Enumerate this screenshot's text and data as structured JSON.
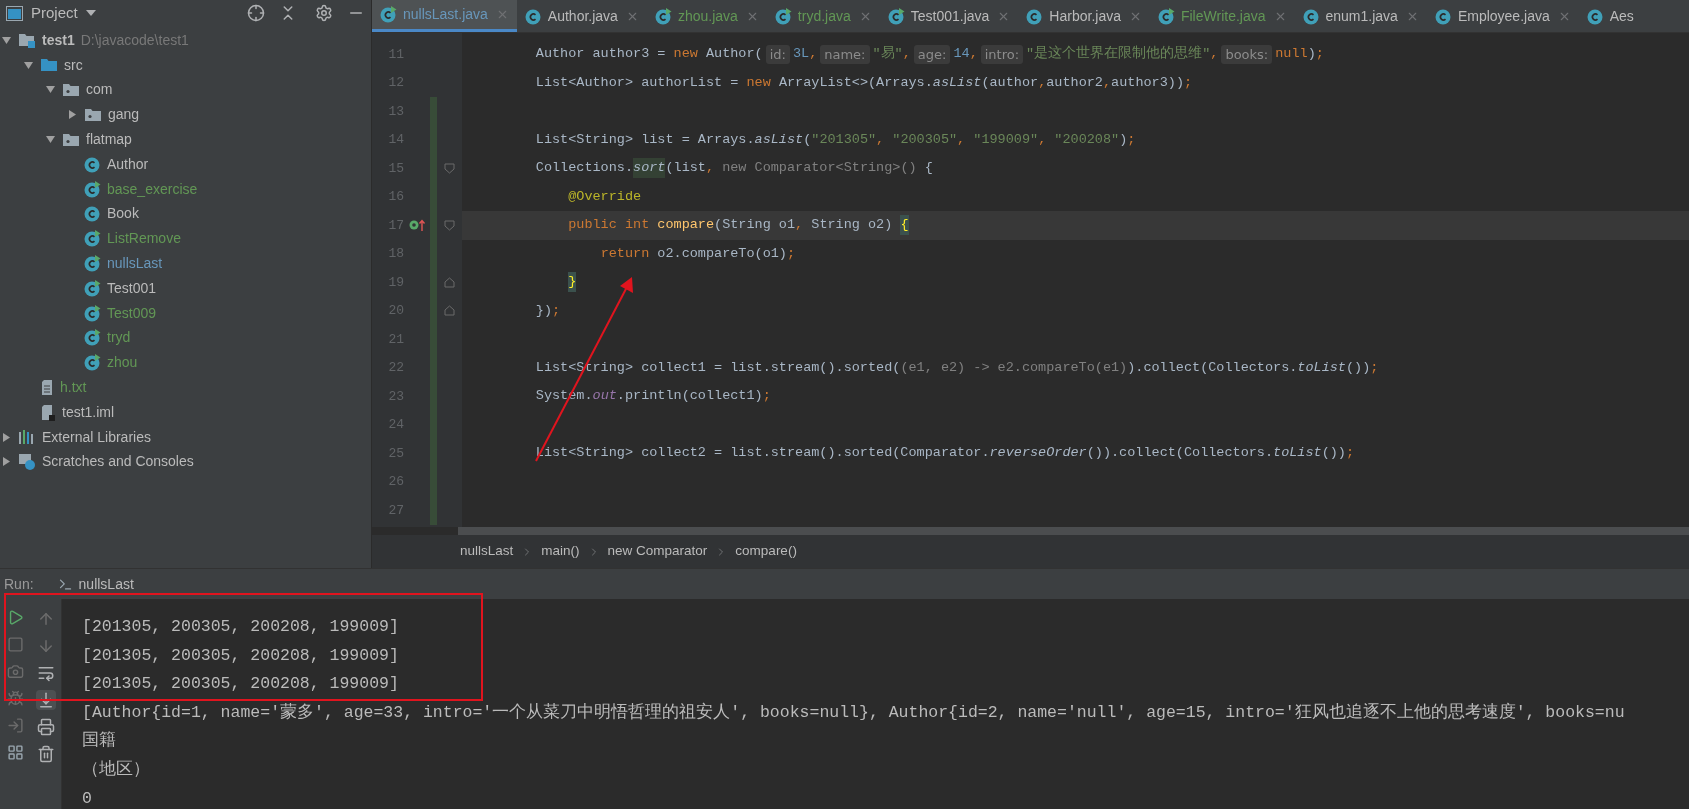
{
  "sidebar": {
    "title": "Project",
    "tree": [
      {
        "label": "test1",
        "kind": "project",
        "hint": "D:\\javacode\\test1",
        "expanded": true,
        "color": "#bbbbbb",
        "children": [
          {
            "label": "src",
            "kind": "source-folder",
            "expanded": true,
            "color": "#bbbbbb",
            "children": [
              {
                "label": "com",
                "kind": "package",
                "expanded": true,
                "color": "#bbbbbb",
                "children": [
                  {
                    "label": "gang",
                    "kind": "package",
                    "expanded": false,
                    "color": "#bbbbbb"
                  }
                ]
              },
              {
                "label": "flatmap",
                "kind": "package",
                "expanded": true,
                "color": "#bbbbbb",
                "children": [
                  {
                    "label": "Author",
                    "kind": "class",
                    "color": "#bbbbbb"
                  },
                  {
                    "label": "base_exercise",
                    "kind": "runnable-class",
                    "color": "#629755"
                  },
                  {
                    "label": "Book",
                    "kind": "class",
                    "color": "#bbbbbb"
                  },
                  {
                    "label": "ListRemove",
                    "kind": "runnable-class",
                    "color": "#629755"
                  },
                  {
                    "label": "nullsLast",
                    "kind": "runnable-class",
                    "color": "#6897bb"
                  },
                  {
                    "label": "Test001",
                    "kind": "runnable-class",
                    "color": "#bbbbbb"
                  },
                  {
                    "label": "Test009",
                    "kind": "runnable-class",
                    "color": "#629755"
                  },
                  {
                    "label": "tryd",
                    "kind": "runnable-class",
                    "color": "#629755"
                  },
                  {
                    "label": "zhou",
                    "kind": "runnable-class",
                    "color": "#629755"
                  }
                ]
              }
            ]
          },
          {
            "label": "h.txt",
            "kind": "text-file",
            "color": "#629755"
          },
          {
            "label": "test1.iml",
            "kind": "module-file",
            "color": "#bbbbbb"
          }
        ]
      },
      {
        "label": "External Libraries",
        "kind": "libraries",
        "expanded": false,
        "color": "#bbbbbb"
      },
      {
        "label": "Scratches and Consoles",
        "kind": "scratches",
        "expanded": false,
        "color": "#bbbbbb"
      }
    ]
  },
  "tabs": [
    {
      "label": "nullsLast.java",
      "kind": "runnable-class",
      "selected": true,
      "color": "#6897bb"
    },
    {
      "label": "Author.java",
      "kind": "class",
      "selected": false,
      "color": "#bbbbbb"
    },
    {
      "label": "zhou.java",
      "kind": "runnable-class",
      "selected": false,
      "color": "#629755"
    },
    {
      "label": "tryd.java",
      "kind": "runnable-class",
      "selected": false,
      "color": "#629755"
    },
    {
      "label": "Test001.java",
      "kind": "runnable-class",
      "selected": false,
      "color": "#bbbbbb"
    },
    {
      "label": "Harbor.java",
      "kind": "class",
      "selected": false,
      "color": "#bbbbbb"
    },
    {
      "label": "FileWrite.java",
      "kind": "runnable-class",
      "selected": false,
      "color": "#629755"
    },
    {
      "label": "enum1.java",
      "kind": "class",
      "selected": false,
      "color": "#bbbbbb"
    },
    {
      "label": "Employee.java",
      "kind": "class",
      "selected": false,
      "color": "#bbbbbb"
    },
    {
      "label": "Aes",
      "kind": "class",
      "selected": false,
      "color": "#bbbbbb"
    }
  ],
  "editor": {
    "lines": [
      {
        "number": "11",
        "current": false,
        "changed": false,
        "tokens": [
          {
            "t": "        Author author3 = ",
            "kind": "plain"
          },
          {
            "t": "new",
            "kind": "keyword"
          },
          {
            "t": " Author(",
            "kind": "plain"
          },
          {
            "t": "id:",
            "kind": "hint"
          },
          {
            "t": "3L",
            "kind": "number"
          },
          {
            "t": ",",
            "kind": "punct"
          },
          {
            "t": "name:",
            "kind": "hint"
          },
          {
            "t": "\"易\"",
            "kind": "string"
          },
          {
            "t": ",",
            "kind": "punct"
          },
          {
            "t": "age:",
            "kind": "hint"
          },
          {
            "t": "14",
            "kind": "number"
          },
          {
            "t": ",",
            "kind": "punct"
          },
          {
            "t": "intro:",
            "kind": "hint"
          },
          {
            "t": "\"是这个世界在限制他的思维\"",
            "kind": "string"
          },
          {
            "t": ",",
            "kind": "punct"
          },
          {
            "t": "books:",
            "kind": "hint"
          },
          {
            "t": "null",
            "kind": "keyword"
          },
          {
            "t": ")",
            "kind": "plain"
          },
          {
            "t": ";",
            "kind": "punct"
          }
        ]
      },
      {
        "number": "12",
        "current": false,
        "changed": false,
        "tokens": [
          {
            "t": "        List<Author> authorList = ",
            "kind": "plain"
          },
          {
            "t": "new",
            "kind": "keyword"
          },
          {
            "t": " ArrayList<>(Arrays.",
            "kind": "plain"
          },
          {
            "t": "asList",
            "kind": "static"
          },
          {
            "t": "(author",
            "kind": "plain"
          },
          {
            "t": ",",
            "kind": "punct"
          },
          {
            "t": "author2",
            "kind": "plain"
          },
          {
            "t": ",",
            "kind": "punct"
          },
          {
            "t": "author3))",
            "kind": "plain"
          },
          {
            "t": ";",
            "kind": "punct"
          }
        ]
      },
      {
        "number": "13",
        "current": false,
        "changed": true
      },
      {
        "number": "14",
        "current": false,
        "changed": true,
        "tokens": [
          {
            "t": "        List<String> list = Arrays.",
            "kind": "plain"
          },
          {
            "t": "asList",
            "kind": "static"
          },
          {
            "t": "(",
            "kind": "plain"
          },
          {
            "t": "\"201305\"",
            "kind": "string"
          },
          {
            "t": ", ",
            "kind": "punct"
          },
          {
            "t": "\"200305\"",
            "kind": "string"
          },
          {
            "t": ", ",
            "kind": "punct"
          },
          {
            "t": "\"199009\"",
            "kind": "string"
          },
          {
            "t": ", ",
            "kind": "punct"
          },
          {
            "t": "\"200208\"",
            "kind": "string"
          },
          {
            "t": ")",
            "kind": "plain"
          },
          {
            "t": ";",
            "kind": "punct"
          }
        ]
      },
      {
        "number": "15",
        "current": false,
        "changed": true,
        "gutter": [
          {
            "kind": "fold-open"
          }
        ],
        "tokens": [
          {
            "t": "        Collections.",
            "kind": "plain"
          },
          {
            "t": "sort",
            "kind": "static-highlight"
          },
          {
            "t": "(list",
            "kind": "plain"
          },
          {
            "t": ", ",
            "kind": "punct"
          },
          {
            "t": "new Comparator<String>() ",
            "kind": "gray"
          },
          {
            "t": "{",
            "kind": "plain"
          }
        ]
      },
      {
        "number": "16",
        "current": false,
        "changed": true,
        "tokens": [
          {
            "t": "            @Override",
            "kind": "annotation"
          }
        ]
      },
      {
        "number": "17",
        "current": true,
        "changed": true,
        "gutter": [
          {
            "kind": "override"
          },
          {
            "kind": "fold-open"
          }
        ],
        "tokens": [
          {
            "t": "            public int ",
            "kind": "keyword"
          },
          {
            "t": "compare",
            "kind": "method"
          },
          {
            "t": "(String o1",
            "kind": "plain"
          },
          {
            "t": ", ",
            "kind": "punct"
          },
          {
            "t": "String o2) ",
            "kind": "plain"
          },
          {
            "t": "{",
            "kind": "brace-match"
          }
        ]
      },
      {
        "number": "18",
        "current": false,
        "changed": true,
        "tokens": [
          {
            "t": "                return ",
            "kind": "keyword"
          },
          {
            "t": "o2.compareTo(o1)",
            "kind": "plain"
          },
          {
            "t": ";",
            "kind": "punct"
          }
        ]
      },
      {
        "number": "19",
        "current": false,
        "changed": true,
        "gutter": [
          {
            "kind": "fold-close"
          }
        ],
        "tokens": [
          {
            "t": "            }",
            "kind": "brace-match"
          }
        ]
      },
      {
        "number": "20",
        "current": false,
        "changed": true,
        "gutter": [
          {
            "kind": "fold-close"
          }
        ],
        "tokens": [
          {
            "t": "        })",
            "kind": "plain"
          },
          {
            "t": ";",
            "kind": "punct"
          }
        ]
      },
      {
        "number": "21",
        "current": false,
        "changed": true
      },
      {
        "number": "22",
        "current": false,
        "changed": true,
        "tokens": [
          {
            "t": "        List<String> collect1 = list.stream().sorted(",
            "kind": "plain"
          },
          {
            "t": "(e1, e2) -> e2.compareTo(e1)",
            "kind": "gray"
          },
          {
            "t": ").collect(Collectors.",
            "kind": "plain"
          },
          {
            "t": "toList",
            "kind": "static"
          },
          {
            "t": "())",
            "kind": "plain"
          },
          {
            "t": ";",
            "kind": "punct"
          }
        ]
      },
      {
        "number": "23",
        "current": false,
        "changed": true,
        "tokens": [
          {
            "t": "        System.",
            "kind": "plain"
          },
          {
            "t": "out",
            "kind": "field"
          },
          {
            "t": ".println(collect1)",
            "kind": "plain"
          },
          {
            "t": ";",
            "kind": "punct"
          }
        ]
      },
      {
        "number": "24",
        "current": false,
        "changed": true
      },
      {
        "number": "25",
        "current": false,
        "changed": true,
        "tokens": [
          {
            "t": "        List<String> collect2 = list.stream().sorted(Comparator.",
            "kind": "plain"
          },
          {
            "t": "reverseOrder",
            "kind": "static"
          },
          {
            "t": "()).collect(Collectors.",
            "kind": "plain"
          },
          {
            "t": "toList",
            "kind": "static"
          },
          {
            "t": "())",
            "kind": "plain"
          },
          {
            "t": ";",
            "kind": "punct"
          }
        ]
      },
      {
        "number": "26",
        "current": false,
        "changed": true
      },
      {
        "number": "27",
        "current": false,
        "changed": true
      }
    ],
    "breadcrumbs": [
      "nullsLast",
      "main()",
      "new Comparator",
      "compare()"
    ]
  },
  "run": {
    "label": "Run:",
    "tab": "nullsLast",
    "console": [
      "[201305, 200305, 200208, 199009]",
      "[201305, 200305, 200208, 199009]",
      "[201305, 200305, 200208, 199009]",
      "[Author{id=1, name='蒙多', age=33, intro='一个从菜刀中明悟哲理的祖安人', books=null}, Author{id=2, name='null', age=15, intro='狂风也追逐不上他的思考速度', books=nu",
      "国籍",
      "（地区）",
      "0"
    ]
  }
}
